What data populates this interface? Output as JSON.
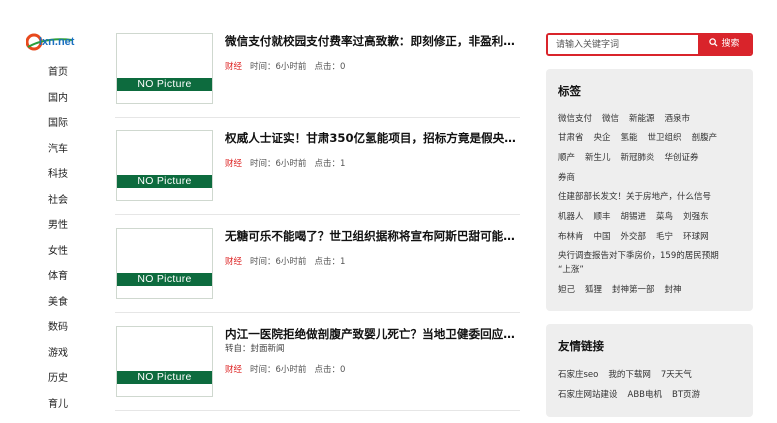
{
  "logo": {
    "text": "lxn.net"
  },
  "nav": [
    "首页",
    "国内",
    "国际",
    "汽车",
    "科技",
    "社会",
    "男性",
    "女性",
    "体育",
    "美食",
    "数码",
    "游戏",
    "历史",
    "育儿"
  ],
  "placeholder_text": "NO Picture",
  "articles": [
    {
      "title": "微信支付就校园支付费率过高致歉：即刻修正，非盈利场…",
      "source": "",
      "category": "财经",
      "time": "时间：6小时前",
      "clicks": "点击：0"
    },
    {
      "title": "权威人士证实！甘肃350亿氢能项目，招标方竟是假央企|…",
      "source": "",
      "category": "财经",
      "time": "时间：6小时前",
      "clicks": "点击：1"
    },
    {
      "title": "无糖可乐不能喝了？世卫组织据称将宣布阿斯巴甜可能致…",
      "source": "",
      "category": "财经",
      "time": "时间：6小时前",
      "clicks": "点击：1"
    },
    {
      "title": "内江一医院拒绝做剖腹产致婴儿死亡？当地卫健委回应|剖…",
      "source": "转自：封面新闻",
      "category": "财经",
      "time": "时间：6小时前",
      "clicks": "点击：0"
    }
  ],
  "search": {
    "placeholder": "请输入关键字词",
    "button": "搜索"
  },
  "tags_panel": {
    "title": "标签",
    "rows": [
      [
        "微信支付",
        "微信",
        "新能源",
        "酒泉市"
      ],
      [
        "甘肃省",
        "央企",
        "氢能",
        "世卫组织",
        "剖腹产"
      ],
      [
        "顺产",
        "新生儿",
        "新冠肺炎",
        "华创证券"
      ],
      [
        "券商"
      ],
      [
        "住建部部长发文！关于房地产，什么信号"
      ],
      [
        "机器人",
        "顺丰",
        "胡锡进",
        "菜鸟",
        "刘强东"
      ],
      [
        "布林肯",
        "中国",
        "外交部",
        "毛宁",
        "环球网"
      ],
      [
        "央行调查报告对下季房价，159的居民预期"
      ],
      [
        "“上涨”"
      ],
      [
        "妲己",
        "狐狸",
        "封神第一部",
        "封神"
      ]
    ]
  },
  "links_panel": {
    "title": "友情链接",
    "rows": [
      [
        "石家庄seo",
        "我的下载网",
        "7天天气"
      ],
      [
        "石家庄网站建设",
        "ABB电机",
        "BT页游"
      ]
    ]
  },
  "colors": {
    "accent": "#d9242b",
    "thumb_band": "#0d6b3e",
    "category": "#dd2222",
    "panel_bg": "#eeeeee"
  }
}
